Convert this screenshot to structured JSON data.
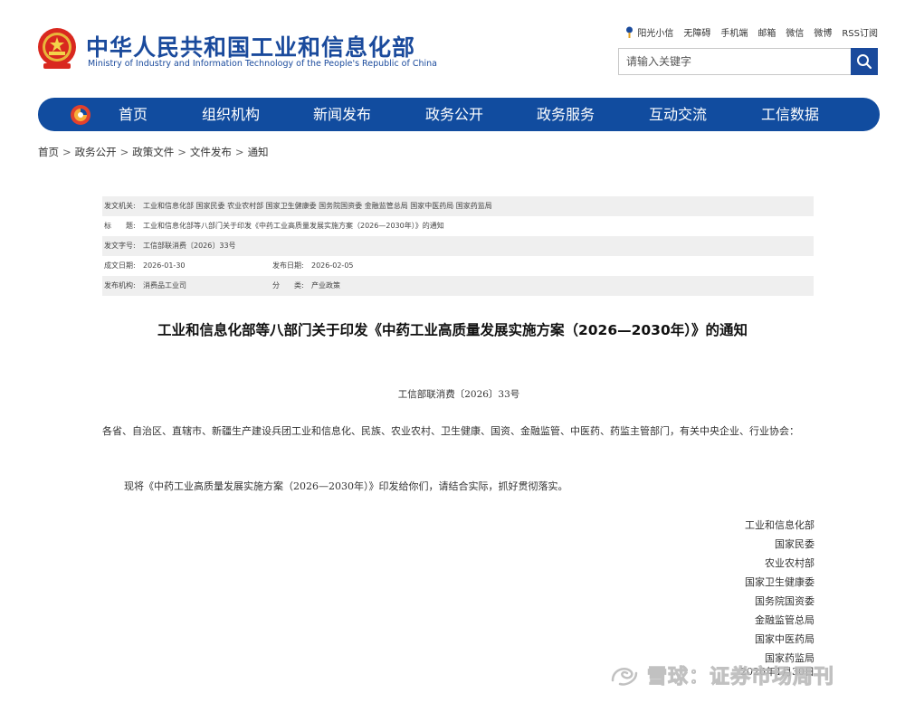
{
  "header": {
    "title_cn": "中华人民共和国工业和信息化部",
    "title_en": "Ministry of Industry and Information Technology of the People's Republic of China",
    "top_links": [
      "阳光小信",
      "无障碍",
      "手机端",
      "邮箱",
      "微信",
      "微博",
      "RSS订阅"
    ],
    "search_placeholder": "请输入关键字"
  },
  "nav": {
    "items": [
      "首页",
      "组织机构",
      "新闻发布",
      "政务公开",
      "政务服务",
      "互动交流",
      "工信数据"
    ]
  },
  "breadcrumb": [
    "首页",
    "政务公开",
    "政策文件",
    "文件发布",
    "通知"
  ],
  "meta": {
    "issuer_label": "发文机关:",
    "issuer_value": "工业和信息化部 国家民委 农业农村部 国家卫生健康委 国务院国资委 金融监管总局 国家中医药局 国家药监局",
    "title_label": "标　　题:",
    "title_value": "工业和信息化部等八部门关于印发《中药工业高质量发展实施方案（2026—2030年）》的通知",
    "docno_label": "发文字号:",
    "docno_value": "工信部联消费〔2026〕33号",
    "created_label": "成文日期:",
    "created_value": "2026-01-30",
    "published_label": "发布日期:",
    "published_value": "2026-02-05",
    "agency_label": "发布机构:",
    "agency_value": "消费品工业司",
    "category_label": "分　　类:",
    "category_value": "产业政策"
  },
  "document": {
    "title": "工业和信息化部等八部门关于印发《中药工业高质量发展实施方案（2026—2030年）》的通知",
    "number": "工信部联消费〔2026〕33号",
    "recipients": "各省、自治区、直辖市、新疆生产建设兵团工业和信息化、民族、农业农村、卫生健康、国资、金融监管、中医药、药监主管部门，有关中央企业、行业协会：",
    "body": "现将《中药工业高质量发展实施方案（2026—2030年）》印发给你们，请结合实际，抓好贯彻落实。",
    "signers": [
      "工业和信息化部",
      "国家民委",
      "农业农村部",
      "国家卫生健康委",
      "国务院国资委",
      "金融监管总局",
      "国家中医药局",
      "国家药监局"
    ],
    "date": "2026年1月30日"
  },
  "watermark": "雪球：证券市场周刊"
}
